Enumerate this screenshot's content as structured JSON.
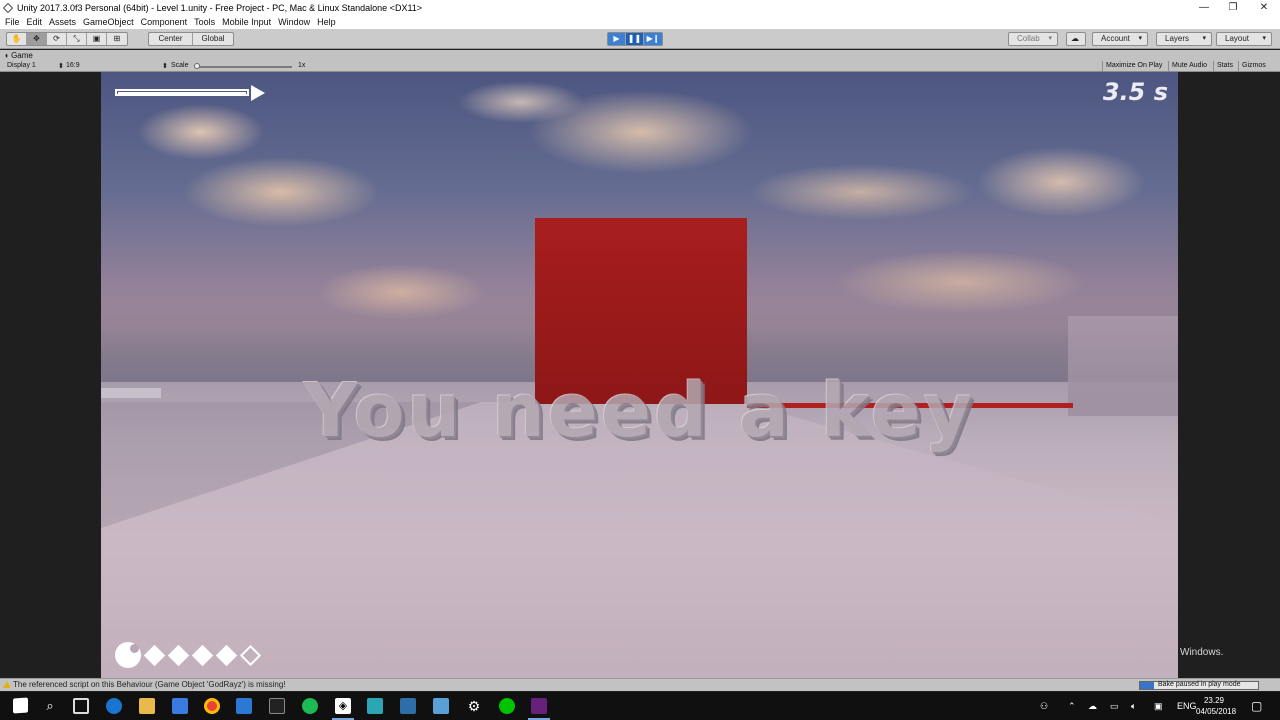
{
  "window": {
    "title": "Unity 2017.3.0f3 Personal (64bit) - Level 1.unity - Free Project - PC, Mac & Linux Standalone <DX11>",
    "controls": [
      "—",
      "❐",
      "✕"
    ]
  },
  "menu": [
    "File",
    "Edit",
    "Assets",
    "GameObject",
    "Component",
    "Tools",
    "Mobile Input",
    "Window",
    "Help"
  ],
  "toolbar": {
    "pivot_center": "Center",
    "pivot_global": "Global",
    "collab": "Collab",
    "account": "Account",
    "layers": "Layers",
    "layout": "Layout"
  },
  "game_view": {
    "tab": "Game",
    "display": "Display 1",
    "aspect": "16:9",
    "scale_label": "Scale",
    "scale_value": "1x",
    "maximize": "Maximize On Play",
    "mute": "Mute Audio",
    "stats": "Stats",
    "gizmos": "Gizmos"
  },
  "hud": {
    "timer": "3.5 s",
    "message": "You need a key",
    "lives_filled": 4,
    "lives_total": 5
  },
  "watermark": "Windows.",
  "status": {
    "message": "The referenced script on this Behaviour (Game Object 'GodRayz') is missing!",
    "bake": "Bake paused in play mode"
  },
  "taskbar": {
    "lang": "ENG",
    "time": "23.29",
    "date": "04/05/2018"
  },
  "colors": {
    "red_cube": "#9b1a1a",
    "play_blue": "#3d7fd4"
  }
}
